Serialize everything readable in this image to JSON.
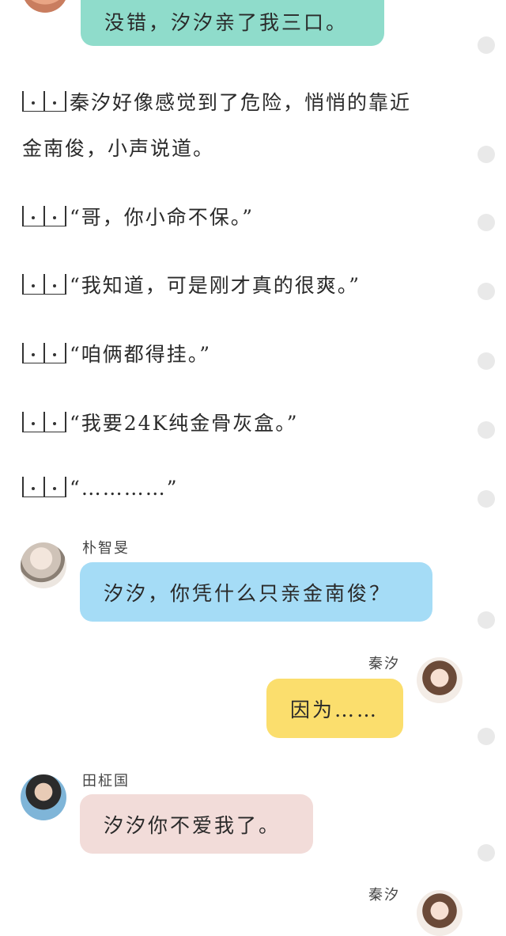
{
  "colors": {
    "bubble_green": "#8fdccb",
    "bubble_blue": "#a5dcf6",
    "bubble_yellow": "#fbde6d",
    "bubble_pink": "#f2dcd9",
    "dot": "#e9e9e9"
  },
  "messages": {
    "top_bubble": "没错，汐汐亲了我三口。",
    "narration_1_line_1": "秦汐好像感觉到了危险，悄悄的靠近",
    "narration_1_line_2": "金南俊，小声说道。",
    "narration_2": "“哥，你小命不保。”",
    "narration_3": "“我知道，可是刚才真的很爽。”",
    "narration_4": "“咱俩都得挂。”",
    "narration_5": "“我要24K纯金骨灰盒。”",
    "narration_6": "“…………”",
    "jimin": {
      "name": "朴智旻",
      "text": "汐汐，你凭什么只亲金南俊？"
    },
    "qinxi_1": {
      "name": "秦汐",
      "text": "因为……"
    },
    "jungkook": {
      "name": "田柾国",
      "text": "汐汐你不爱我了。"
    },
    "qinxi_2": {
      "name": "秦汐"
    }
  }
}
